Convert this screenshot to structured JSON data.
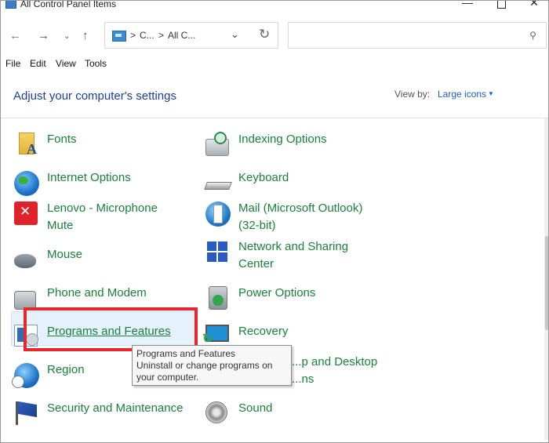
{
  "window": {
    "title": "All Control Panel Items"
  },
  "address": {
    "crumb1": "C...",
    "crumb2": "All C...",
    "separator": ">"
  },
  "search": {
    "placeholder": ""
  },
  "menu": {
    "file": "File",
    "edit": "Edit",
    "view": "View",
    "tools": "Tools"
  },
  "header": {
    "title": "Adjust your computer's settings",
    "view_by_label": "View by:",
    "view_by_value": "Large icons"
  },
  "left_items": [
    {
      "label": "Fonts",
      "icon": "fonts-icon"
    },
    {
      "label": "Internet Options",
      "icon": "internet-options-icon"
    },
    {
      "label_line1": "Lenovo - Microphone",
      "label_line2": "Mute",
      "icon": "lenovo-icon"
    },
    {
      "label": "Mouse",
      "icon": "mouse-icon"
    },
    {
      "label": "Phone and Modem",
      "icon": "phone-icon"
    },
    {
      "label": "Programs and Features",
      "icon": "programs-icon"
    },
    {
      "label": "Region",
      "icon": "region-icon"
    },
    {
      "label": "Security and Maintenance",
      "icon": "flag-icon"
    }
  ],
  "right_items": [
    {
      "label": "Indexing Options",
      "icon": "indexing-icon"
    },
    {
      "label": "Keyboard",
      "icon": "keyboard-icon"
    },
    {
      "label_line1": "Mail (Microsoft Outlook)",
      "label_line2": "(32-bit)",
      "icon": "mail-icon"
    },
    {
      "label_line1": "Network and Sharing",
      "label_line2": "Center",
      "icon": "network-icon"
    },
    {
      "label": "Power Options",
      "icon": "power-icon"
    },
    {
      "label": "Recovery",
      "icon": "recovery-icon"
    },
    {
      "label_line1": "...p and Desktop",
      "label_line2": "...ns",
      "icon": "remote-icon"
    },
    {
      "label": "Sound",
      "icon": "sound-icon"
    }
  ],
  "tooltip": {
    "title": "Programs and Features",
    "description": "Uninstall or change programs on your computer."
  },
  "colors": {
    "link_green": "#19813b",
    "title_blue": "#1e3f9a",
    "highlight_red": "#e8262d"
  }
}
